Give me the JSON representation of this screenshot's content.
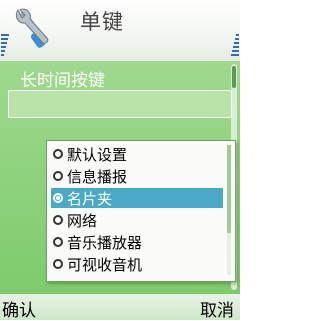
{
  "header": {
    "title": "单键",
    "icon": "wrench-screwdriver-icon",
    "accent_color": "#2f6fb0"
  },
  "setting": {
    "label": "长时间按键",
    "bg_color": "#8dd27b"
  },
  "popup": {
    "options": [
      {
        "label": "默认设置",
        "selected": false
      },
      {
        "label": "信息播报",
        "selected": false
      },
      {
        "label": "名片夹",
        "selected": true
      },
      {
        "label": "网络",
        "selected": false
      },
      {
        "label": "音乐播放器",
        "selected": false
      },
      {
        "label": "可视收音机",
        "selected": false
      }
    ],
    "highlight_color": "#4aa9c6"
  },
  "softkeys": {
    "left": "确认",
    "right": "取消"
  }
}
